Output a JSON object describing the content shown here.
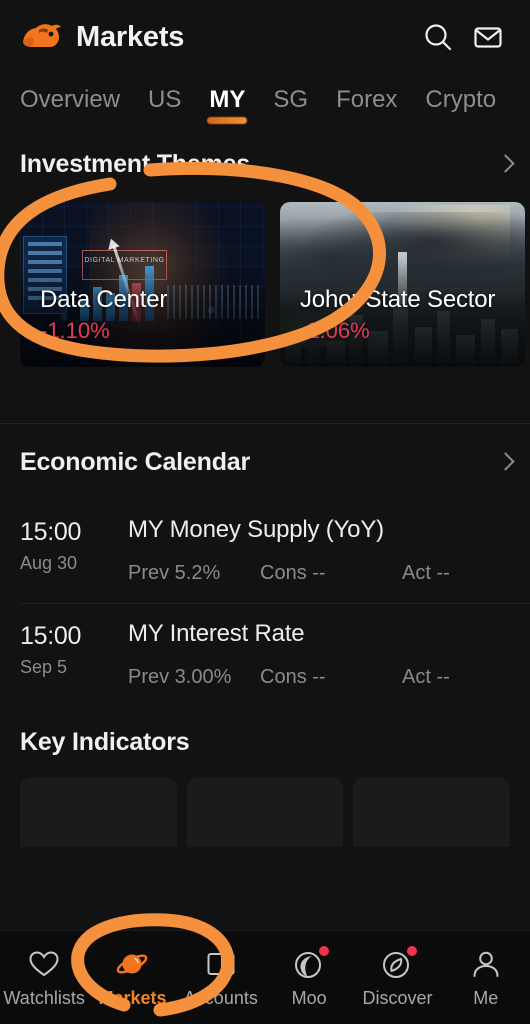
{
  "colors": {
    "background": "#121212",
    "accent_orange": "#f28420",
    "annotation_orange": "#f5913c",
    "negative_red": "#e8385a",
    "badge_red": "#f0334d",
    "text_primary": "#ededed",
    "text_secondary": "#8a8a8d"
  },
  "header": {
    "title": "Markets",
    "logo_icon": "moomoo-bull-logo",
    "search_icon": "search-icon",
    "mail_icon": "mail-icon"
  },
  "market_tabs": {
    "active": "MY",
    "items": [
      {
        "label": "Overview"
      },
      {
        "label": "US"
      },
      {
        "label": "MY"
      },
      {
        "label": "SG"
      },
      {
        "label": "Forex"
      },
      {
        "label": "Crypto"
      }
    ]
  },
  "investment_themes": {
    "title": "Investment Themes",
    "chevron_icon": "chevron-right-icon",
    "cards": [
      {
        "name": "Data Center",
        "change": "-1.10%",
        "art": "digital-marketing-dashboard-image",
        "art_caption": "DIGITAL MARKETING"
      },
      {
        "name": "Johor State Sector",
        "change": "-2.06%",
        "art": "city-skyline-rainbow-image"
      }
    ]
  },
  "economic_calendar": {
    "title": "Economic Calendar",
    "chevron_icon": "chevron-right-icon",
    "stat_labels": {
      "prev": "Prev",
      "cons": "Cons",
      "act": "Act"
    },
    "rows": [
      {
        "time": "15:00",
        "date": "Aug 30",
        "event": "MY Money Supply (YoY)",
        "prev": "Prev 5.2%",
        "cons": "Cons --",
        "act": "Act --"
      },
      {
        "time": "15:00",
        "date": "Sep 5",
        "event": "MY Interest Rate",
        "prev": "Prev 3.00%",
        "cons": "Cons --",
        "act": "Act --"
      }
    ]
  },
  "key_indicators": {
    "title": "Key Indicators"
  },
  "bottom_nav": {
    "active": "Markets",
    "items": [
      {
        "label": "Watchlists",
        "icon": "heart-icon",
        "badge": false
      },
      {
        "label": "Markets",
        "icon": "planet-icon",
        "badge": false
      },
      {
        "label": "Accounts",
        "icon": "card-icon",
        "badge": false
      },
      {
        "label": "Moo",
        "icon": "moo-icon",
        "badge": true
      },
      {
        "label": "Discover",
        "icon": "compass-icon",
        "badge": true
      },
      {
        "label": "Me",
        "icon": "person-icon",
        "badge": false
      }
    ]
  },
  "annotations": [
    {
      "name": "circle-investment-themes",
      "shape": "hand-drawn-ellipse"
    },
    {
      "name": "circle-markets-nav",
      "shape": "hand-drawn-ellipse"
    }
  ]
}
